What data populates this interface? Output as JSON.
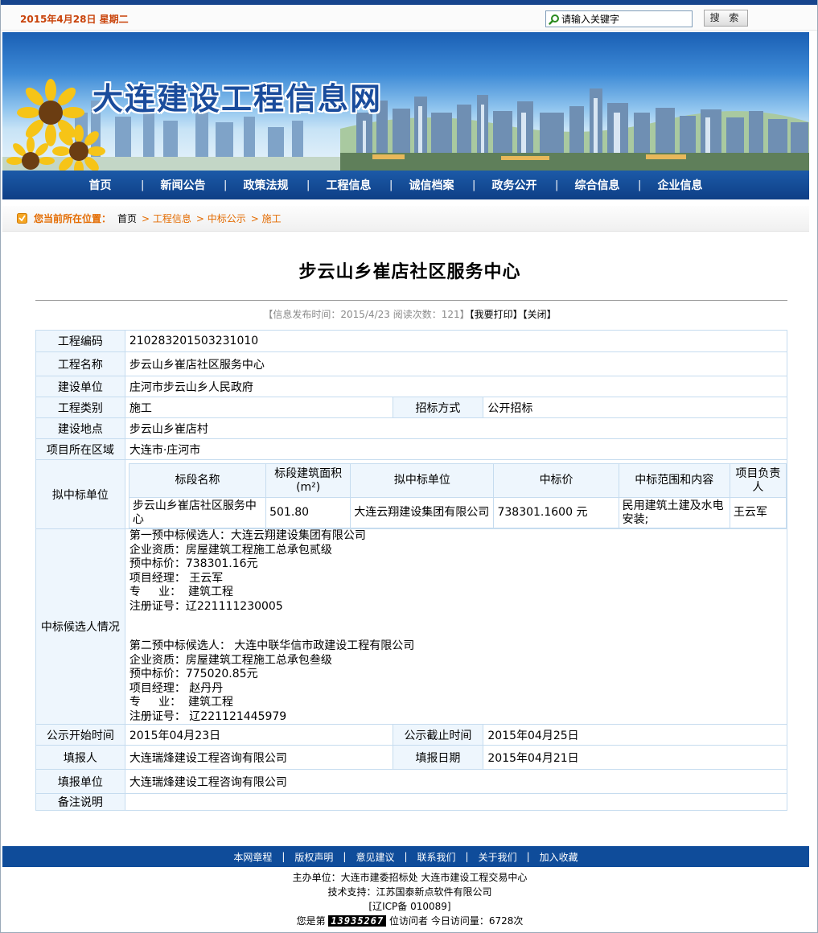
{
  "header": {
    "date": "2015年4月28日 星期二",
    "search_placeholder": "请输入关键字",
    "search_button": "搜 索",
    "site_title": "大连建设工程信息网"
  },
  "nav": {
    "items": [
      "首页",
      "新闻公告",
      "政策法规",
      "工程信息",
      "诚信档案",
      "政务公开",
      "综合信息",
      "企业信息"
    ]
  },
  "breadcrumb": {
    "label": "您当前所在位置：",
    "home": "首页",
    "crumbs": [
      "> 工程信息",
      "> 中标公示",
      "> 施工"
    ]
  },
  "doc": {
    "title": "步云山乡崔店社区服务中心",
    "meta_prefix": "【信息发布时间：2015/4/23  阅读次数：121】",
    "print_link": "【我要打印】",
    "close_link": "【关闭】"
  },
  "info": {
    "project_code_label": "工程编码",
    "project_code": "210283201503231010",
    "project_name_label": "工程名称",
    "project_name": "步云山乡崔店社区服务中心",
    "builder_label": "建设单位",
    "builder": "庄河市步云山乡人民政府",
    "type_label": "工程类别",
    "type": "施工",
    "bid_method_label": "招标方式",
    "bid_method": "公开招标",
    "location_label": "建设地点",
    "location": "步云山乡崔店村",
    "region_label": "项目所在区域",
    "region": "大连市·庄河市",
    "winner_label": "拟中标单位",
    "winner_table": {
      "headers": [
        "标段名称",
        "标段建筑面积(m²)",
        "拟中标单位",
        "中标价",
        "中标范围和内容",
        "项目负责人"
      ],
      "row": [
        "步云山乡崔店社区服务中心",
        "501.80",
        "大连云翔建设集团有限公司",
        "738301.1600  元",
        "民用建筑土建及水电安装;",
        "王云军"
      ]
    },
    "candidates_label": "中标候选人情况",
    "candidate1": [
      "第一预中标候选人：大连云翔建设集团有限公司",
      "企业资质：房屋建筑工程施工总承包贰级",
      "预中标价：738301.16元",
      "项目经理：  王云军",
      "专     业：  建筑工程",
      "注册证号：辽221111230005"
    ],
    "candidate2": [
      "第二预中标候选人：  大连中联华信市政建设工程有限公司",
      "企业资质：房屋建筑工程施工总承包叁级",
      "预中标价：775020.85元",
      "项目经理：  赵丹丹",
      "专     业：  建筑工程",
      "注册证号：  辽221121445979"
    ],
    "start_label": "公示开始时间",
    "start": "2015年04月23日",
    "end_label": "公示截止时间",
    "end": "2015年04月25日",
    "filer_label": "填报人",
    "filer": "大连瑞烽建设工程咨询有限公司",
    "file_date_label": "填报日期",
    "file_date": "2015年04月21日",
    "filer_unit_label": "填报单位",
    "filer_unit": "大连瑞烽建设工程咨询有限公司",
    "remark_label": "备注说明",
    "remark": ""
  },
  "footer": {
    "links": [
      "本网章程",
      "版权声明",
      "意见建议",
      "联系我们",
      "关于我们",
      "加入收藏"
    ],
    "sponsor": "主办单位：大连市建委招标处 大连市建设工程交易中心",
    "tech": "技术支持：江苏国泰新点软件有限公司",
    "icp": "[辽ICP备 010089]",
    "visitor_prefix": "您是第",
    "visitor_count": "13935267",
    "visitor_suffix": "位访问者  今日访问量：6728次"
  },
  "colors": {
    "accent": "#c9430a",
    "nav_blue": "#0f4c9a",
    "crumb_orange": "#e36b00",
    "label_bg": "#eef6fd",
    "border": "#c6dcef"
  }
}
